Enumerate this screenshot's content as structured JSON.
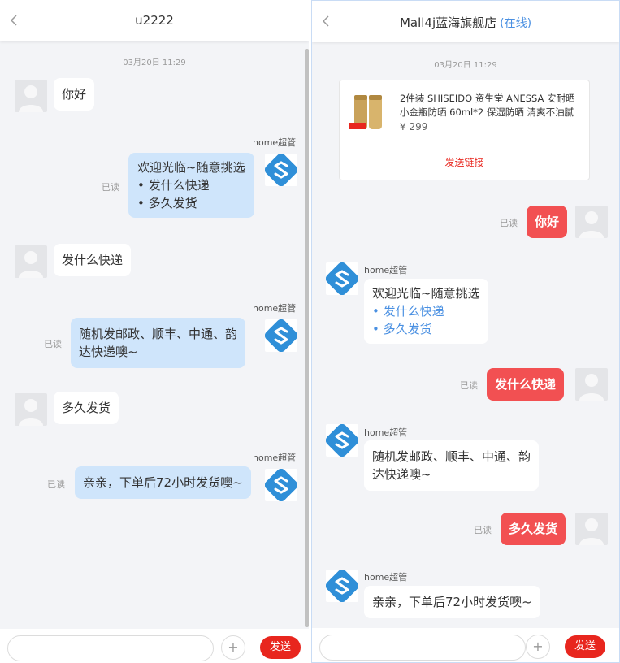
{
  "left": {
    "title": "u2222",
    "timestamp": "03月20日 11:29",
    "messages": {
      "m1": "你好",
      "m2_name": "home超管",
      "m2_read": "已读",
      "m2_line1": "欢迎光临~随意挑选",
      "m2_line2": "• 发什么快递",
      "m2_line3": "• 多久发货",
      "m3": "发什么快递",
      "m4_name": "home超管",
      "m4_read": "已读",
      "m4_line1": "随机发邮政、顺丰、中通、韵",
      "m4_line2": "达快递噢~",
      "m5": "多久发货",
      "m6_name": "home超管",
      "m6_read": "已读",
      "m6": "亲亲，下单后72小时发货噢~"
    },
    "footer": {
      "placeholder": "",
      "send_label": "发送",
      "plus_label": "+"
    }
  },
  "right": {
    "title": "Mall4j蓝海旗舰店",
    "status": "(在线)",
    "timestamp": "03月20日 11:29",
    "product": {
      "title": "2件装 SHISEIDO 资生堂 ANESSA 安耐晒 小金瓶防晒 60ml*2 保湿防晒 清爽不油腻",
      "price": "¥ 299",
      "link_label": "发送链接"
    },
    "messages": {
      "m1_read": "已读",
      "m1": "你好",
      "m2_name": "home超管",
      "m2_line1": "欢迎光临~随意挑选",
      "m2_line2": "• 发什么快递",
      "m2_line3": "• 多久发货",
      "m3_read": "已读",
      "m3": "发什么快递",
      "m4_name": "home超管",
      "m4_line1": "随机发邮政、顺丰、中通、韵",
      "m4_line2": "达快递噢~",
      "m5_read": "已读",
      "m5": "多久发货",
      "m6_name": "home超管",
      "m6": "亲亲，下单后72小时发货噢~"
    },
    "footer": {
      "placeholder": "",
      "send_label": "发送",
      "plus_label": "+"
    }
  },
  "colors": {
    "accent_red": "#e8261e",
    "bubble_blue": "#cfe5fb",
    "bubble_red": "#f25052",
    "link_blue": "#4a90e2"
  },
  "icons": {
    "back": "chevron-left-icon",
    "shop_avatar": "mall4j-logo-icon",
    "user_avatar": "user-silhouette-icon"
  }
}
